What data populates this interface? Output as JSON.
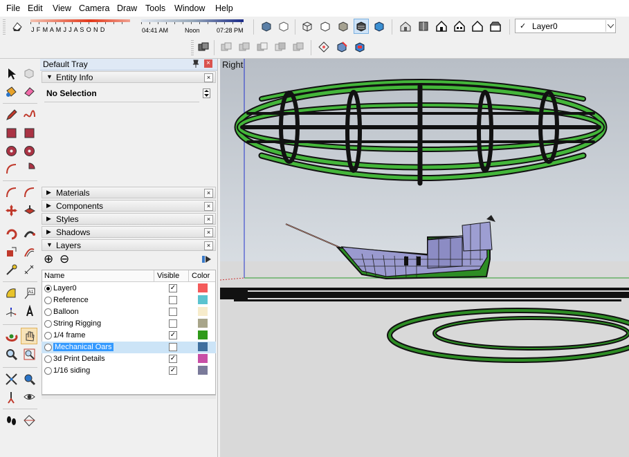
{
  "menu": [
    "File",
    "Edit",
    "View",
    "Camera",
    "Draw",
    "Tools",
    "Window",
    "Help"
  ],
  "shadow": {
    "months": "J F M A M J J A S O N D",
    "time_start": "04:41 AM",
    "time_mid": "Noon",
    "time_end": "07:28 PM"
  },
  "layer_select": {
    "value": "Layer0",
    "check": "✓"
  },
  "tray": {
    "title": "Default Tray",
    "pin": "📌",
    "entity_info": {
      "label": "Entity Info",
      "selection": "No Selection"
    },
    "sections": [
      "Materials",
      "Components",
      "Styles",
      "Shadows",
      "Layers"
    ],
    "layers_header": {
      "name": "Name",
      "visible": "Visible",
      "color": "Color"
    },
    "layers": [
      {
        "name": "Layer0",
        "active": true,
        "visible": true,
        "color": "#f45a5a"
      },
      {
        "name": "Reference",
        "active": false,
        "visible": false,
        "color": "#5bc3cf"
      },
      {
        "name": "Balloon",
        "active": false,
        "visible": false,
        "color": "#f7eccb"
      },
      {
        "name": "String Rigging",
        "active": false,
        "visible": false,
        "color": "#a8a58a"
      },
      {
        "name": "1/4 frame",
        "active": false,
        "visible": true,
        "color": "#2f9a1a"
      },
      {
        "name": "Mechanical Oars",
        "active": false,
        "visible": false,
        "color": "#3f6f9e",
        "selected": true
      },
      {
        "name": "3d Print Details",
        "active": false,
        "visible": true,
        "color": "#c84fa6"
      },
      {
        "name": "1/16 siding",
        "active": false,
        "visible": true,
        "color": "#7a7a9a"
      }
    ]
  },
  "viewport": {
    "view_label": "Right"
  },
  "icons": {
    "add_layer": "⊕",
    "remove_layer": "⊖",
    "layer_details": "▶",
    "close": "×",
    "expand": "▼",
    "collapse": "▶",
    "dropdown": "⌄"
  }
}
